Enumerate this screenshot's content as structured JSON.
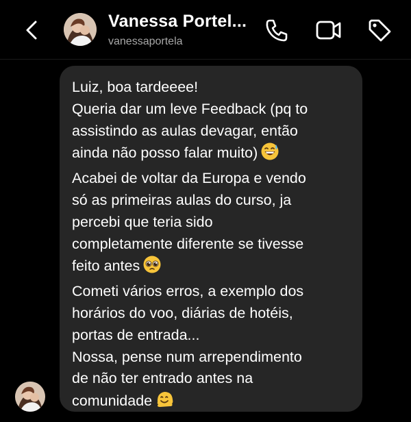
{
  "header": {
    "back_icon": "chevron-left-icon",
    "avatar_icon": "profile-photo",
    "name": "Vanessa Portel...",
    "username": "vanessaportela",
    "actions": [
      {
        "icon": "phone-icon"
      },
      {
        "icon": "video-camera-icon"
      },
      {
        "icon": "tag-icon"
      }
    ]
  },
  "message": {
    "lines": [
      "Luiz, boa tardeeee!",
      "Queria dar um leve Feedback (pq to",
      "assistindo as aulas devagar, então",
      "ainda não posso falar muito)",
      "Acabei de voltar da Europa e vendo",
      "só as primeiras aulas do curso, ja",
      "percebi que teria sido",
      "completamente diferente se tivesse",
      "feito antes",
      "Cometi vários erros, a exemplo dos",
      "horários do voo, diárias de hotéis,",
      "portas de entrada...",
      "Nossa, pense num arrependimento",
      "de não ter entrado antes na",
      "comunidade"
    ],
    "emojis": [
      "grinning-sweat-emoji",
      "pleading-face-emoji",
      "melting-face-emoji"
    ]
  },
  "colors": {
    "background": "#000000",
    "bubble": "#262626",
    "text": "#ffffff",
    "secondary_text": "#a8a8a8"
  }
}
